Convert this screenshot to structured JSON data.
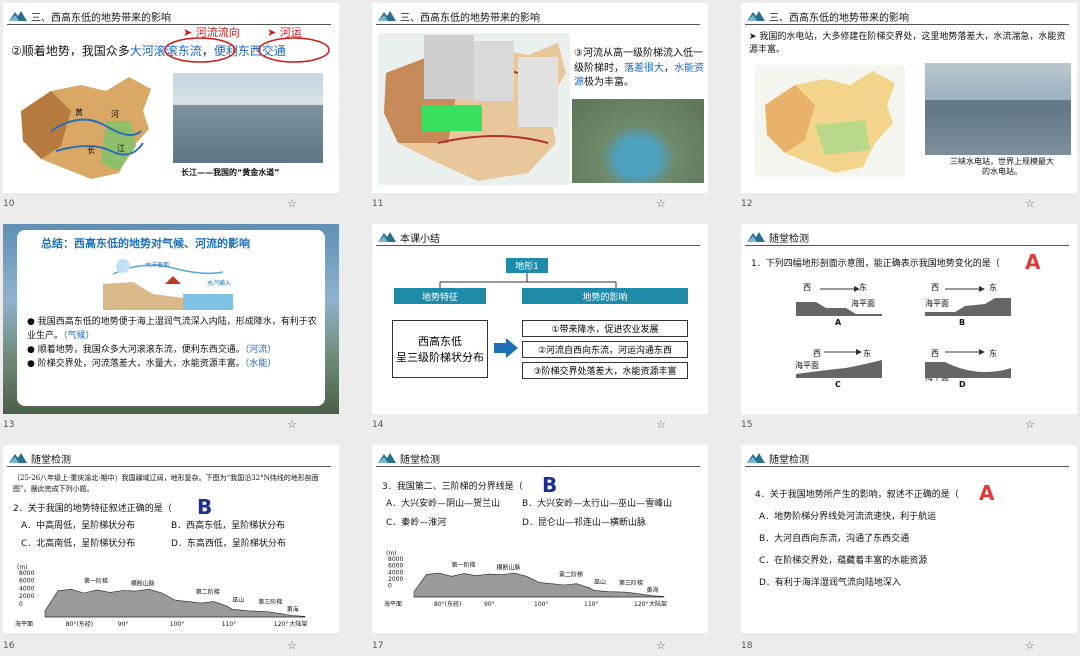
{
  "slides": [
    {
      "num": "10",
      "title": "三、西高东低的地势带来的影响",
      "line": "②顺着地势，我国众多",
      "hl1": "大河滚滚东流",
      "sep": "，",
      "hl2": "便利东西交通",
      "anno1": "河流流向",
      "anno2": "河运",
      "caption": "长江——我国的“黄金水道”",
      "map_labels": {
        "huang": "黄",
        "he": "河",
        "chang": "长",
        "jiang": "江"
      }
    },
    {
      "num": "11",
      "title": "三、西高东低的地势带来的影响",
      "line1": "③河流从高一级阶梯流入低一级阶梯时，",
      "hl1": "落差很大",
      "mid": "，",
      "hl2": "水能资源",
      "line3": "极为丰富。"
    },
    {
      "num": "12",
      "title": "三、西高东低的地势带来的影响",
      "bullet": "我国的水电站，大多修建在阶梯交界处，这里地势落差大，水流湍急，水能资源丰富。",
      "caption": "三峡水电站，世界上规模最大的水电站。"
    },
    {
      "num": "13",
      "title": "总结：西高东低的地势对气候、河流的影响",
      "diagram_labels": [
        "大洋表面",
        "水汽输入"
      ],
      "bullets": [
        {
          "text": "我国西高东低的地势便于海上湿润气流深入内陆，形成降水，有利于农业生产。",
          "tag": "（气候）"
        },
        {
          "text": "顺着地势，我国众多大河滚滚东流，便利东西交通。",
          "tag": "（河流）"
        },
        {
          "text": "阶梯交界处，河流落差大，水量大，水能资源丰富。",
          "tag": "（水能）"
        }
      ]
    },
    {
      "num": "14",
      "title": "本课小结",
      "root": "地形1",
      "left_head": "地势特征",
      "right_head": "地势的影响",
      "left_box": "西高东低\n呈三级阶梯状分布",
      "items": [
        "①带来降水，促进农业发展",
        "②河流自西向东流，河运沟通东西",
        "③阶梯交界处落差大，水能资源丰富"
      ]
    },
    {
      "num": "15",
      "title": "随堂检测",
      "question": "1．下列四幅地形剖面示意图，能正确表示我国地势变化的是（",
      "answer": "A",
      "west": "西",
      "east": "东",
      "sea": "海平面",
      "opts": [
        "A",
        "B",
        "C",
        "D"
      ]
    },
    {
      "num": "16",
      "title": "随堂检测",
      "source": "（25-26八年级上·重庆渝北·期中）我国疆域辽阔，地形复杂。下图为“我国沿32°N纬线的地形剖面图”。据此完成下列小题。",
      "question": "2．关于我国的地势特征叙述正确的是（",
      "answer": "B",
      "opts": [
        "A．中高周低，呈阶梯状分布",
        "B．西高东低，呈阶梯状分布",
        "C．北高南低，呈阶梯状分布",
        "D．东高西低，呈阶梯状分布"
      ],
      "profile": {
        "unit": "(m)",
        "yticks": [
          "8000",
          "6000",
          "4000",
          "2000",
          "0"
        ],
        "sea": "海平面",
        "steps": [
          "第一阶梯",
          "第二阶梯",
          "第三阶梯"
        ],
        "features": [
          "横断山脉",
          "巫山",
          "黄海",
          "大陆架"
        ],
        "xticks": [
          "80°(东经)",
          "90°",
          "100°",
          "110°",
          "120°"
        ]
      }
    },
    {
      "num": "17",
      "title": "随堂检测",
      "question": "3．我国第二、三阶梯的分界线是（",
      "answer": "B",
      "opts": [
        "A．大兴安岭—阴山—贺兰山",
        "B．大兴安岭—太行山—巫山—雪峰山",
        "C．秦岭—淮河",
        "D．昆仑山—祁连山—横断山脉"
      ],
      "profile": {
        "unit": "(m)",
        "yticks": [
          "8000",
          "6000",
          "4000",
          "2000",
          "0"
        ],
        "sea": "海平面",
        "steps": [
          "第一阶梯",
          "第二阶梯",
          "第三阶梯"
        ],
        "features": [
          "横断山脉",
          "巫山",
          "黄海",
          "大陆架"
        ],
        "xticks": [
          "80°(东经)",
          "90°",
          "100°",
          "110°",
          "120°"
        ]
      }
    },
    {
      "num": "18",
      "title": "随堂检测",
      "question": "4．关于我国地势所产生的影响，叙述不正确的是（",
      "answer": "A",
      "opts": [
        "A．地势阶梯分界线处河流流速快，利于航运",
        "B．大河自西向东流，沟通了东西交通",
        "C．在阶梯交界处，蕴藏着丰富的水能资源",
        "D．有利于海洋湿润气流向陆地深入"
      ]
    }
  ],
  "colors": {
    "accent": "#1d8cab",
    "red": "#d01a1a",
    "blue": "#1a66c2"
  }
}
